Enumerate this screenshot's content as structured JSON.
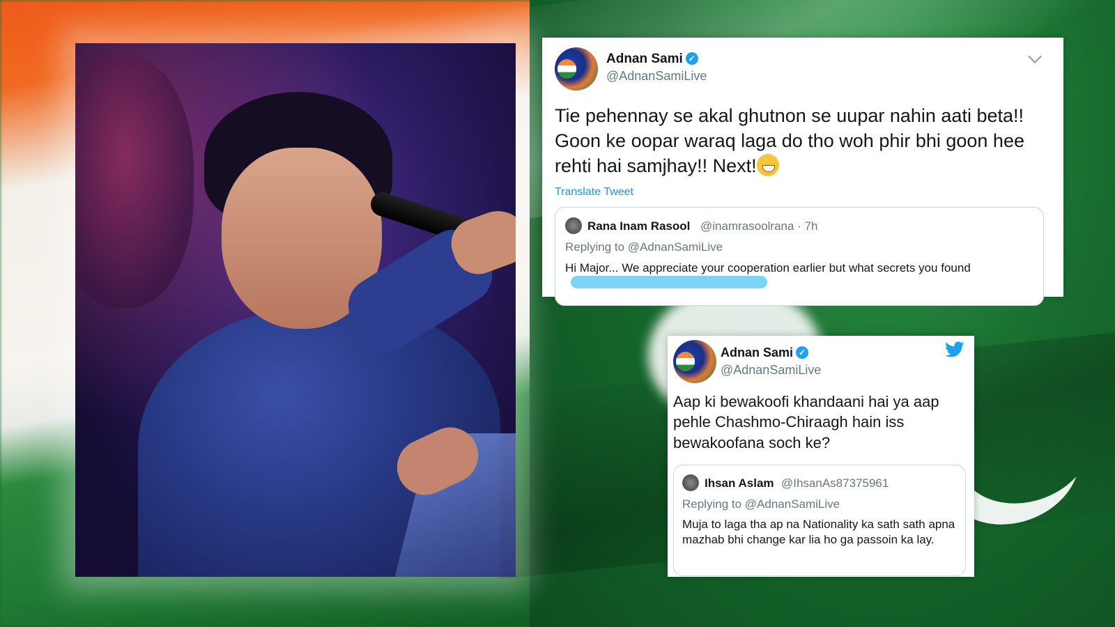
{
  "tweet1": {
    "name": "Adnan Sami",
    "handle": "@AdnanSamiLive",
    "text": "Tie pehennay se akal ghutnon se uupar nahin aati beta!! Goon ke oopar waraq laga do tho woh phir bhi goon hee rehti hai samjhay!! Next!",
    "translate": "Translate Tweet",
    "quote": {
      "name": "Rana Inam Rasool",
      "handle": "@inamrasoolrana",
      "time": "· 7h",
      "replying": "Replying to @AdnanSamiLive",
      "text": "Hi Major... We appreciate your cooperation earlier but what secrets you found"
    }
  },
  "tweet2": {
    "name": "Adnan Sami",
    "handle": "@AdnanSamiLive",
    "text": "Aap ki bewakoofi khandaani hai ya aap pehle Chashmo-Chiraagh hain iss bewakoofana soch ke?",
    "quote": {
      "name": "Ihsan Aslam",
      "handle": "@IhsanAs87375961",
      "replying": "Replying to @AdnanSamiLive",
      "text": "Muja to laga tha ap na Nationality ka sath sath apna mazhab bhi change kar lia ho ga passoin ka lay."
    }
  },
  "colors": {
    "twitter_blue": "#1da1f2",
    "link_blue": "#1b95e0",
    "saffron": "#ef5a1a",
    "green": "#1f7a33"
  },
  "icons": [
    "verified-badge-icon",
    "chevron-down-icon",
    "twitter-bird-icon",
    "grinning-emoji-icon"
  ]
}
